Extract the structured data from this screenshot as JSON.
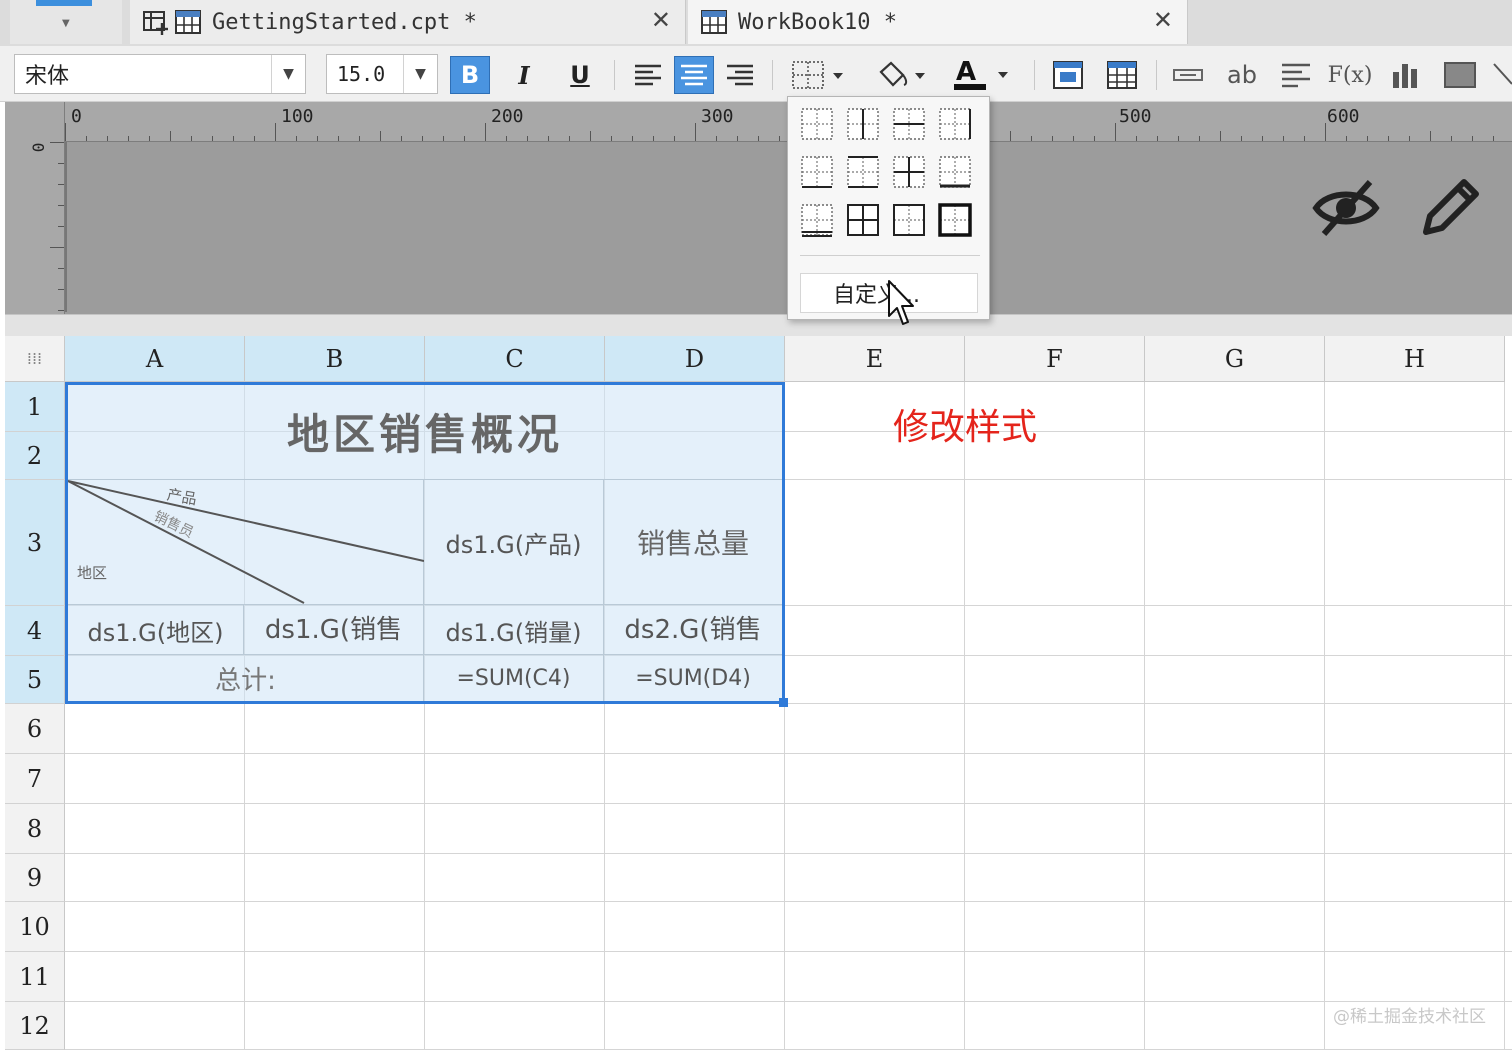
{
  "tabs": [
    {
      "name": "GettingStarted.cpt *",
      "close": "✕"
    },
    {
      "name": "WorkBook10 *",
      "close": "✕"
    }
  ],
  "toolbar": {
    "font_family": "宋体",
    "font_size": "15.0",
    "bold": "B",
    "italic": "I",
    "underline": "U",
    "ab_label": "ab",
    "formula_label": "F(x)"
  },
  "ruler": {
    "h_labels": [
      "0",
      "100",
      "200",
      "300",
      "500",
      "600"
    ],
    "v_label": "0"
  },
  "popup": {
    "custom_label": "自定义..."
  },
  "sheet": {
    "columns": [
      "A",
      "B",
      "C",
      "D",
      "E",
      "F",
      "G",
      "H"
    ],
    "rows": [
      "1",
      "2",
      "3",
      "4",
      "5",
      "6",
      "7",
      "8",
      "9",
      "10",
      "11",
      "12"
    ],
    "title": "地区销售概况",
    "diag_product": "产品",
    "diag_sales": "销售员",
    "diag_region": "地区",
    "c3": "ds1.G(产品)",
    "d3": "销售总量",
    "a4": "ds1.G(地区)",
    "b4": "ds1.G(销售",
    "c4": "ds1.G(销量)",
    "d4": "ds2.G(销售",
    "a5": "总计:",
    "c5": "=SUM(C4)",
    "d5": "=SUM(D4)"
  },
  "annotation": "修改样式",
  "watermark": "@稀土掘金技术社区",
  "colors": {
    "selection_border": "#2f7ad8",
    "annotation": "#e4241b",
    "active_button": "#4a94e0"
  }
}
